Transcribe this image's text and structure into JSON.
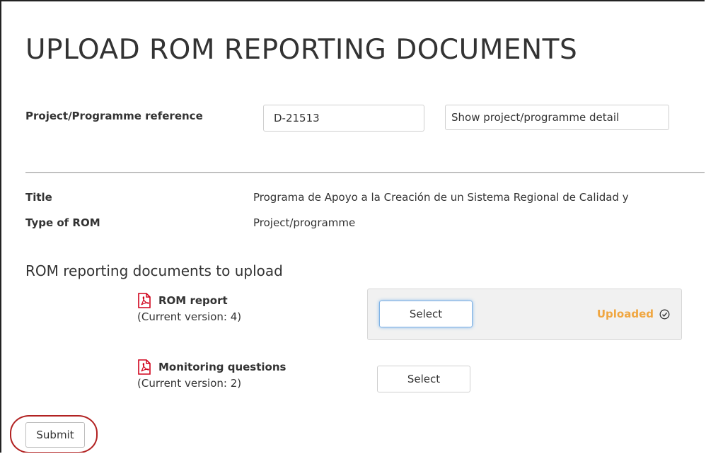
{
  "page": {
    "title": "UPLOAD ROM REPORTING DOCUMENTS"
  },
  "reference": {
    "label": "Project/Programme reference",
    "value": "D-21513",
    "detail_button_label": "Show project/programme detail"
  },
  "details": {
    "title_label": "Title",
    "title_value": "Programa de Apoyo a la Creación de un Sistema Regional de Calidad y",
    "type_label": "Type of ROM",
    "type_value": "Project/programme"
  },
  "documents": {
    "heading": "ROM reporting documents to upload",
    "items": [
      {
        "name": "ROM report",
        "version": "(Current version: 4)",
        "select_label": "Select",
        "status": "Uploaded",
        "icon": "pdf-icon"
      },
      {
        "name": "Monitoring questions",
        "version": "(Current version: 2)",
        "select_label": "Select",
        "icon": "pdf-icon"
      }
    ]
  },
  "actions": {
    "submit_label": "Submit"
  },
  "colors": {
    "status_uploaded": "#f0a640",
    "pdf_icon": "#d0021b",
    "highlight_ring": "#b22222"
  }
}
